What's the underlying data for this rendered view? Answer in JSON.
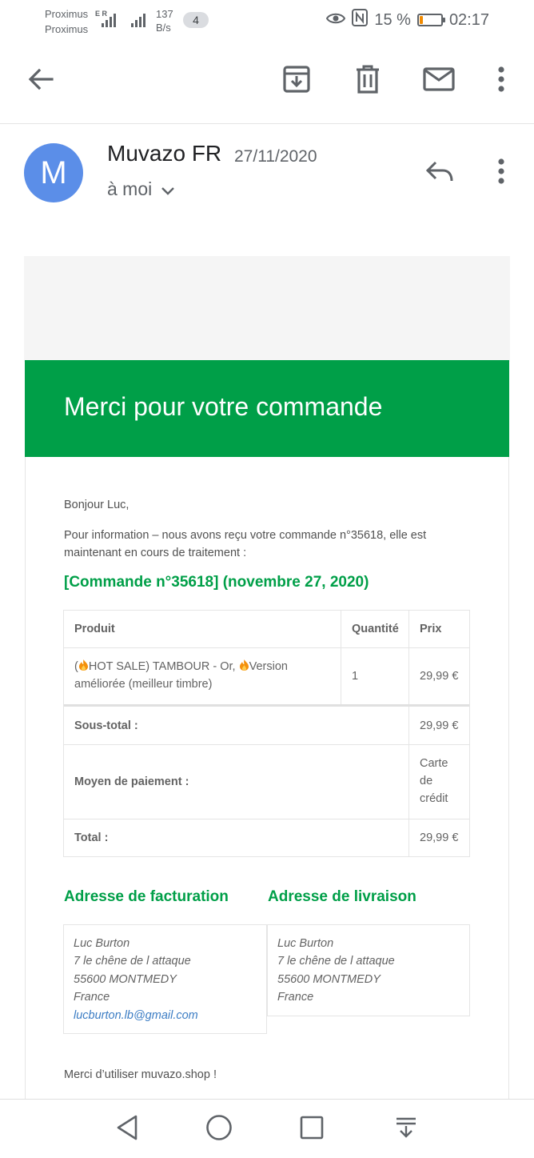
{
  "status_bar": {
    "carrier_1": "Proximus",
    "carrier_2": "Proximus",
    "network_tag": "E R",
    "net_speed_value": "137",
    "net_speed_unit": "B/s",
    "notification_count": "4",
    "battery_percent": "15 %",
    "battery_level": 0.15,
    "time": "02:17"
  },
  "toolbar": {
    "back_icon": "arrow-left-icon",
    "archive_icon": "archive-icon",
    "delete_icon": "trash-icon",
    "mark_unread_icon": "mail-icon",
    "more_icon": "more-vert-icon"
  },
  "message_header": {
    "avatar_letter": "M",
    "avatar_color": "#5b8ee8",
    "sender": "Muvazo FR",
    "date": "27/11/2020",
    "recipient": "à moi"
  },
  "email": {
    "banner_title": "Merci pour votre commande",
    "banner_color": "#009f48",
    "greeting": "Bonjour Luc,",
    "intro_line_1": "Pour information – nous avons reçu votre commande n°35618, elle est",
    "intro_line_2": "maintenant en cours de traitement :",
    "order_heading": "[Commande n°35618] (novembre 27, 2020)",
    "table": {
      "headers": [
        "Produit",
        "Quantité",
        "Prix"
      ],
      "item": {
        "name_part_1": "(",
        "name_part_2": "HOT SALE) TAMBOUR - Or, ",
        "name_part_3": "Version",
        "name_line_2": "améliorée (meilleur timbre)",
        "quantity": "1",
        "price": "29,99 €"
      },
      "subtotal_label": "Sous-total :",
      "subtotal_value": "29,99 €",
      "payment_label": "Moyen de paiement :",
      "payment_value_lines": [
        "Carte",
        "de",
        "crédit"
      ],
      "total_label": "Total :",
      "total_value": "29,99 €"
    },
    "billing": {
      "heading": "Adresse de facturation",
      "name": "Luc Burton",
      "street": "7 le chêne de l attaque",
      "city": "55600 MONTMEDY",
      "country": "France",
      "email": "lucburton.lb@gmail.com"
    },
    "shipping": {
      "heading": "Adresse de livraison",
      "name": "Luc Burton",
      "street": "7 le chêne de l attaque",
      "city": "55600 MONTMEDY",
      "country": "France"
    },
    "closing": "Merci d’utiliser muvazo.shop !"
  },
  "nav_bar": {
    "back_icon": "nav-back-triangle-icon",
    "home_icon": "nav-home-circle-icon",
    "recents_icon": "nav-recents-square-icon",
    "notifications_icon": "nav-pull-down-icon"
  }
}
